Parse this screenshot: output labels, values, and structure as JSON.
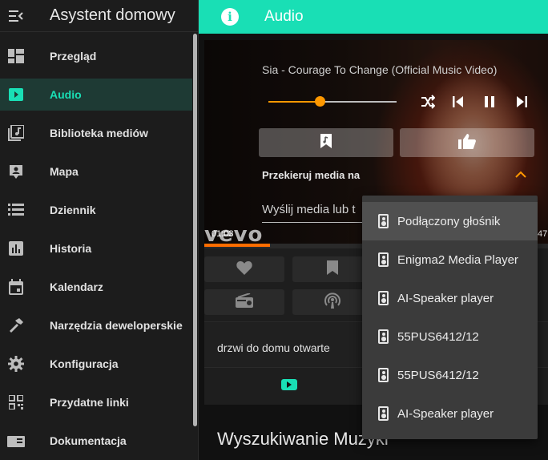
{
  "app": {
    "title": "Asystent domowy"
  },
  "colors": {
    "accent": "#19dfb5",
    "media": "#ff9800",
    "sidebar_bg": "#1c1c1c",
    "active_bg": "#1e3a34"
  },
  "sidebar": {
    "items": [
      {
        "label": "Przegląd",
        "icon": "dashboard-icon",
        "active": false
      },
      {
        "label": "Audio",
        "icon": "play-box-icon",
        "active": true
      },
      {
        "label": "Biblioteka mediów",
        "icon": "media-library-icon",
        "active": false
      },
      {
        "label": "Mapa",
        "icon": "map-account-icon",
        "active": false
      },
      {
        "label": "Dziennik",
        "icon": "list-icon",
        "active": false
      },
      {
        "label": "Historia",
        "icon": "chart-bar-icon",
        "active": false
      },
      {
        "label": "Kalendarz",
        "icon": "calendar-icon",
        "active": false
      },
      {
        "label": "Narzędzia deweloperskie",
        "icon": "hammer-icon",
        "active": false
      },
      {
        "label": "Konfiguracja",
        "icon": "cog-icon",
        "active": false
      },
      {
        "label": "Przydatne linki",
        "icon": "qrcode-icon",
        "active": false
      },
      {
        "label": "Dokumentacja",
        "icon": "book-icon",
        "active": false
      }
    ]
  },
  "topbar": {
    "title": "Audio",
    "info_icon": "i"
  },
  "player": {
    "song_title": "Sia - Courage To Change (Official Music Video)",
    "volume_fraction": 0.4,
    "redirect_label": "Przekieruj media na",
    "send_media_placeholder": "Wyślij media lub t",
    "time_elapsed": "01:03",
    "time_remaining_fragment": "47",
    "progress_fraction": 0.19,
    "watermark": "vevo"
  },
  "notice": {
    "text": "drzwi do domu otwarte"
  },
  "search": {
    "title": "Wyszukiwanie Muzyki"
  },
  "dropdown": {
    "items": [
      {
        "label": "Podłączony głośnik",
        "selected": true
      },
      {
        "label": "Enigma2 Media Player",
        "selected": false
      },
      {
        "label": "AI-Speaker player",
        "selected": false
      },
      {
        "label": "55PUS6412/12",
        "selected": false
      },
      {
        "label": "55PUS6412/12",
        "selected": false
      },
      {
        "label": "AI-Speaker player",
        "selected": false
      }
    ]
  }
}
